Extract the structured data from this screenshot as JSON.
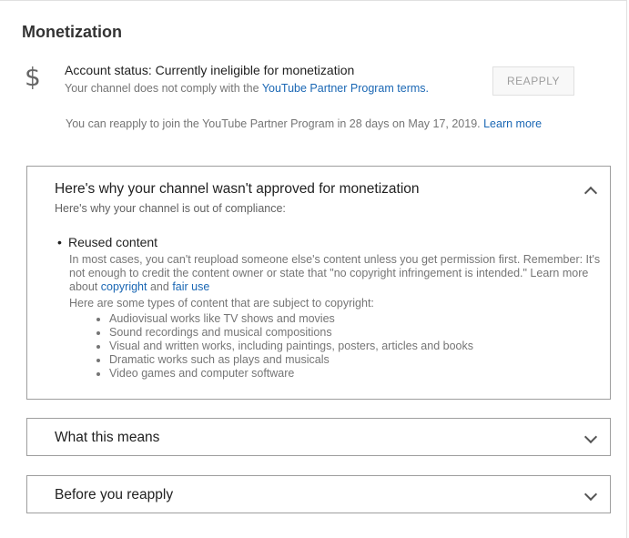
{
  "section_title": "Monetization",
  "icon": "dollar-icon",
  "status": {
    "title": "Account status: Currently ineligible for monetization",
    "line_prefix": "Your channel does not comply with the ",
    "line_link": "YouTube Partner Program terms.",
    "button": "REAPPLY"
  },
  "note": {
    "text": "You can reapply to join the YouTube Partner Program in 28 days on May 17, 2019. ",
    "link": "Learn more"
  },
  "panels": {
    "why": {
      "title": "Here's why your channel wasn't approved for monetization",
      "subtitle": "Here's why your channel is out of compliance:",
      "bullet": "Reused content",
      "body": "In most cases, you can't reupload someone else's content unless you get permission first. Remember: It's not enough to credit the content owner or state that \"no copyright infringement is intended.\" Learn more about ",
      "link_copyright": "copyright",
      "and": " and ",
      "link_fair_use": "fair use",
      "types_intro": "Here are some types of content that are subject to copyright:",
      "types": [
        "Audiovisual works like TV shows and movies",
        "Sound recordings and musical compositions",
        "Visual and written works, including paintings, posters, articles and books",
        "Dramatic works such as plays and musicals",
        "Video games and computer software"
      ]
    },
    "means": {
      "title": "What this means"
    },
    "before": {
      "title": "Before you reapply"
    }
  },
  "colors": {
    "link": "#1a67b4",
    "muted": "#757575"
  }
}
